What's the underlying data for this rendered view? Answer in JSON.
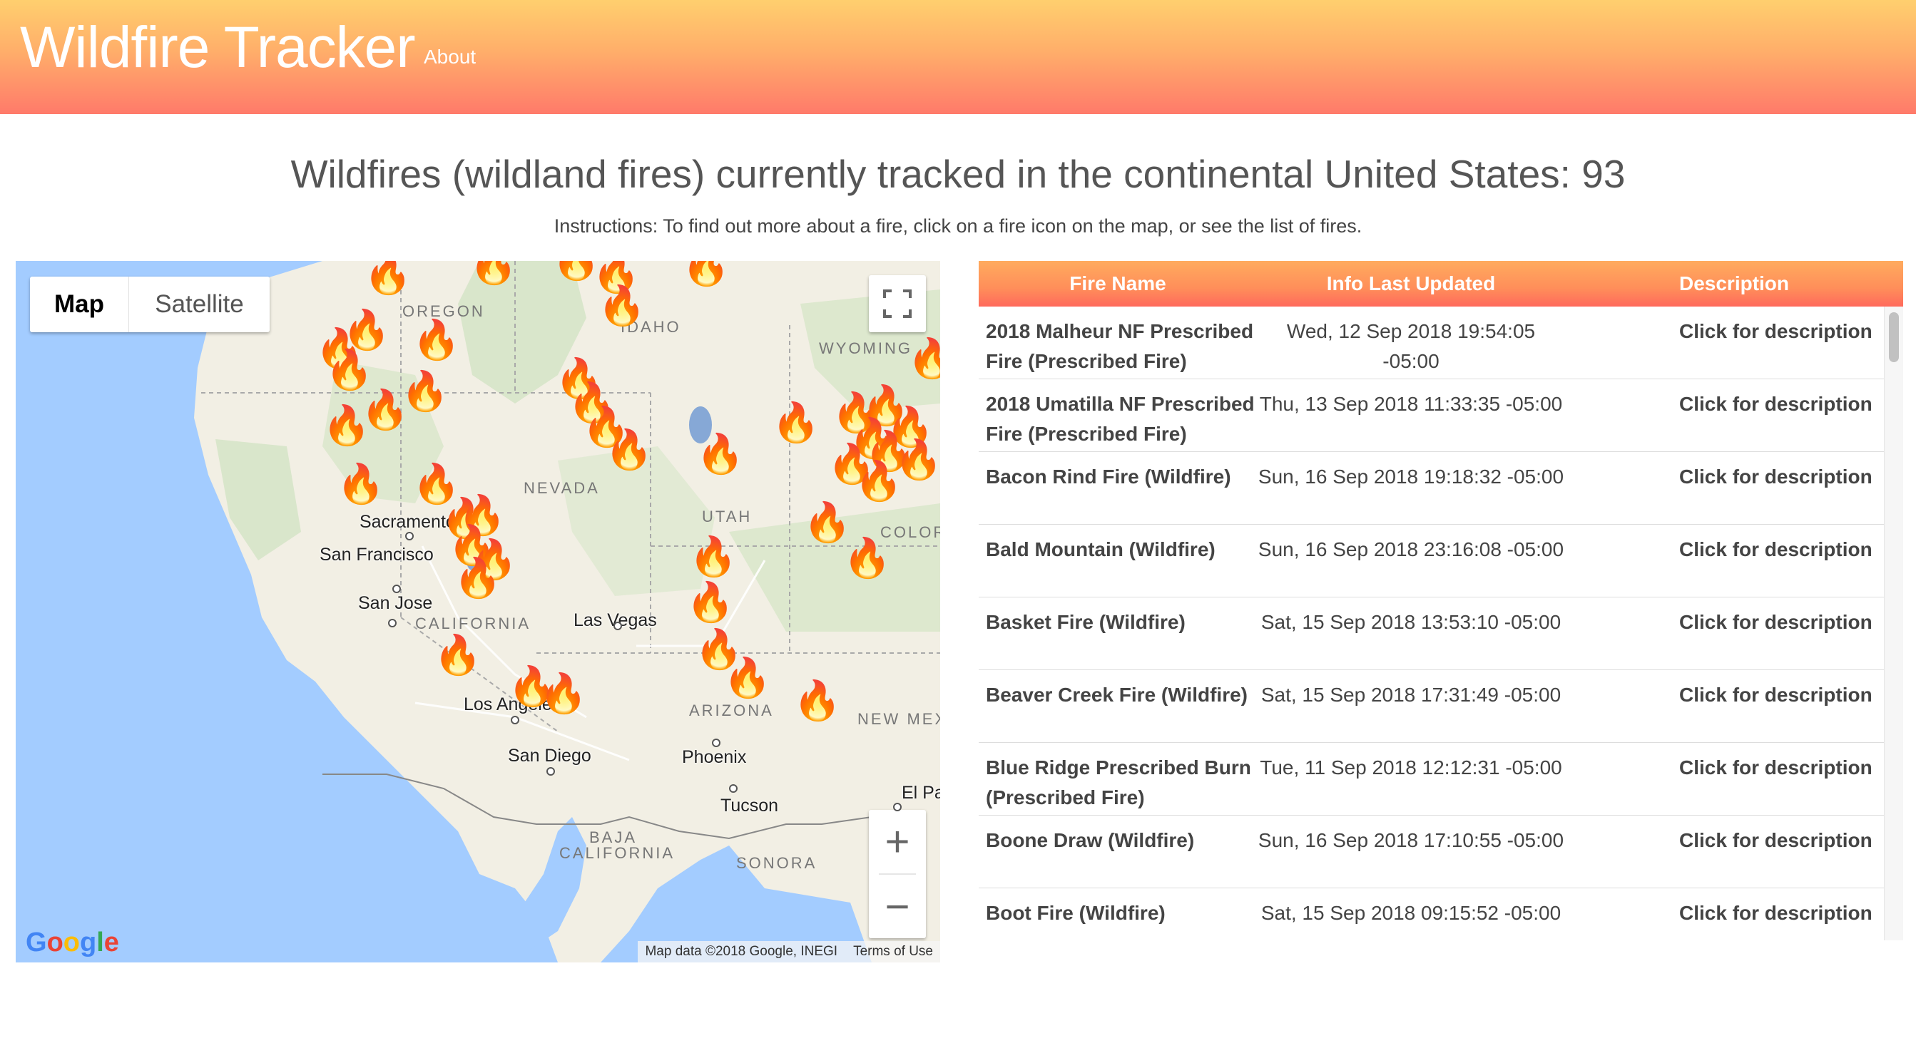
{
  "navbar": {
    "brand": "Wildfire Tracker",
    "about": "About"
  },
  "heading": "Wildfires (wildland fires) currently tracked in the continental United States: 93",
  "instructions": "Instructions: To find out more about a fire, click on a fire icon on the map, or see the list of fires.",
  "map": {
    "type_map": "Map",
    "type_satellite": "Satellite",
    "zoom_in": "+",
    "zoom_out": "−",
    "google": "Google",
    "attribution": "Map data ©2018 Google, INEGI",
    "terms": "Terms of Use",
    "labels": {
      "oregon": "OREGON",
      "idaho": "IDAHO",
      "wyoming": "WYOMING",
      "nevada": "NEVADA",
      "utah": "UTAH",
      "colorado": "COLOR",
      "california": "CALIFORNIA",
      "arizona": "ARIZONA",
      "new_mexico": "NEW MEX",
      "baja": "BAJA",
      "baja2": "CALIFORNIA",
      "sonora": "SONORA",
      "sacramento": "Sacramento",
      "san_francisco": "San Francisco",
      "san_jose": "San Jose",
      "las_vegas": "Las Vegas",
      "los_angeles": "Los Angeles",
      "san_diego": "San Diego",
      "phoenix": "Phoenix",
      "tucson": "Tucson",
      "el_paso": "El Pa"
    },
    "fire_icon": "🔥"
  },
  "table": {
    "headers": [
      "Fire Name",
      "Info Last Updated",
      "Description"
    ],
    "rows": [
      {
        "name": "2018 Malheur NF Prescribed Fire (Prescribed Fire)",
        "updated": "Wed, 12 Sep 2018 19:54:05 -05:00",
        "desc": "Click for description"
      },
      {
        "name": "2018 Umatilla NF Prescribed Fire (Prescribed Fire)",
        "updated": "Thu, 13 Sep 2018 11:33:35 -05:00",
        "desc": "Click for description"
      },
      {
        "name": "Bacon Rind Fire (Wildfire)",
        "updated": "Sun, 16 Sep 2018 19:18:32 -05:00",
        "desc": "Click for description"
      },
      {
        "name": "Bald Mountain (Wildfire)",
        "updated": "Sun, 16 Sep 2018 23:16:08 -05:00",
        "desc": "Click for description"
      },
      {
        "name": "Basket Fire (Wildfire)",
        "updated": "Sat, 15 Sep 2018 13:53:10 -05:00",
        "desc": "Click for description"
      },
      {
        "name": "Beaver Creek Fire (Wildfire)",
        "updated": "Sat, 15 Sep 2018 17:31:49 -05:00",
        "desc": "Click for description"
      },
      {
        "name": "Blue Ridge Prescribed Burn (Prescribed Fire)",
        "updated": "Tue, 11 Sep 2018 12:12:31 -05:00",
        "desc": "Click for description"
      },
      {
        "name": "Boone Draw (Wildfire)",
        "updated": "Sun, 16 Sep 2018 17:10:55 -05:00",
        "desc": "Click for description"
      },
      {
        "name": "Boot Fire (Wildfire)",
        "updated": "Sat, 15 Sep 2018 09:15:52 -05:00",
        "desc": "Click for description"
      }
    ]
  },
  "colors": {
    "header_top": "#ffcf6e",
    "header_bottom": "#ff7a6a",
    "water": "#a3ccff",
    "land": "#f2efe4"
  }
}
